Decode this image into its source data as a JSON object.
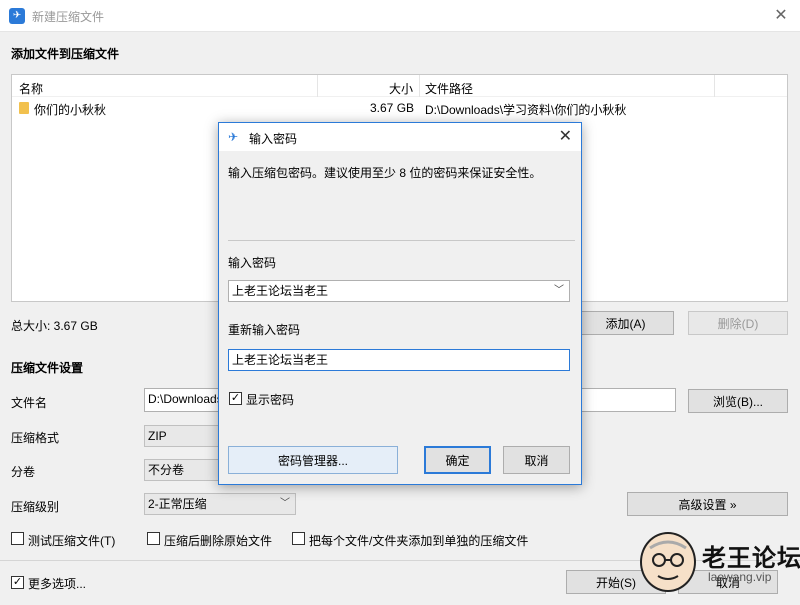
{
  "window": {
    "title": "新建压缩文件",
    "close_glyph": "✕",
    "icon": "app-icon"
  },
  "add_section": {
    "title": "添加文件到压缩文件",
    "columns": [
      "名称",
      "大小",
      "文件路径"
    ],
    "rows": [
      {
        "name": "你们的小秋秋",
        "size": "3.67 GB",
        "path": "D:\\Downloads\\学习资料\\你们的小秋秋",
        "icon": "folder-icon"
      }
    ],
    "total_size": "总大小: 3.67 GB",
    "add_button": "添加(A)",
    "delete_button": "删除(D)"
  },
  "settings": {
    "title": "压缩文件设置",
    "filename_label": "文件名",
    "filename_value": "D:\\Downloads\\学习资料\\你们的小秋秋.zip",
    "browse_button": "浏览(B)...",
    "format_label": "压缩格式",
    "format_value": "ZIP",
    "split_label": "分卷",
    "split_value": "不分卷",
    "level_label": "压缩级别",
    "level_value": "2-正常压缩",
    "advanced_button": "高级设置 »",
    "test_archive": "测试压缩文件(T)",
    "delete_after": "压缩后删除原始文件",
    "separate_archives": "把每个文件/文件夹添加到单独的压缩文件",
    "more_options": "更多选项...",
    "more_options_checked": true,
    "start_button": "开始(S)",
    "cancel_button": "取消"
  },
  "dialog": {
    "title": "输入密码",
    "close_glyph": "✕",
    "description": "输入压缩包密码。建议使用至少 8 位的密码来保证安全性。",
    "password_label": "输入密码",
    "password_value": "上老王论坛当老王",
    "reenter_label": "重新输入密码",
    "reenter_value": "上老王论坛当老王",
    "show_password": "显示密码",
    "show_password_checked": true,
    "manager_button": "密码管理器...",
    "ok_button": "确定",
    "cancel_button": "取消"
  },
  "watermark": {
    "text": "老王论坛",
    "url": "laowang.vip"
  },
  "colors": {
    "accent": "#2b7ad8",
    "folder": "#f2c14e"
  }
}
